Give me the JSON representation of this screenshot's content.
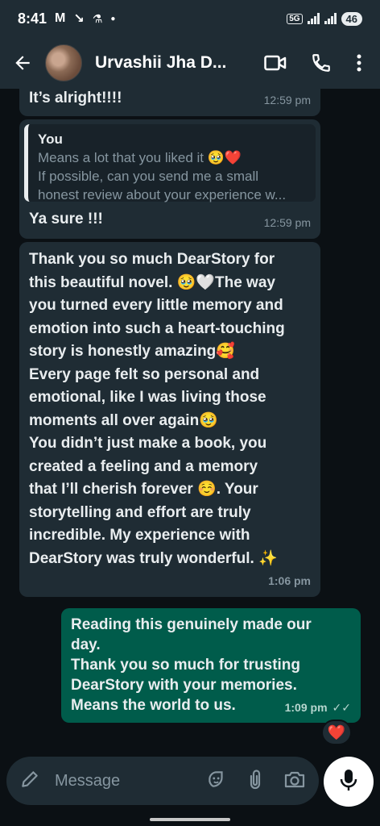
{
  "status_bar": {
    "time": "8:41",
    "network": "5G",
    "battery": "46"
  },
  "header": {
    "contact_name": "Urvashii Jha D...",
    "back_icon": "arrow-left-icon",
    "video_icon": "video-camera-icon",
    "call_icon": "phone-icon",
    "menu_icon": "more-vertical-icon"
  },
  "messages": [
    {
      "direction": "incoming",
      "text": "It’s alright!!!!",
      "time": "12:59 pm"
    },
    {
      "direction": "incoming",
      "quote_author": "You",
      "quote_line1": "Means a lot that you liked it 🥹❤️",
      "quote_line2": "If possible, can you send me a small",
      "quote_line3": "honest review about your experience w...",
      "text": "Ya sure !!!",
      "time": "12:59 pm"
    },
    {
      "direction": "incoming",
      "lines": [
        "Thank you so much DearStory for",
        "this beautiful novel. 🥹🤍The way",
        "you turned every little memory and",
        "emotion into such a heart-touching",
        "story is honestly amazing🥰",
        "Every page felt so personal and",
        "emotional, like I was living those",
        "moments all over again🥹",
        "You didn’t just make a book, you",
        "created a feeling and a memory",
        "that I’ll cherish forever ☺️.  Your",
        "storytelling and effort are truly",
        "incredible. My experience with",
        "DearStory was truly wonderful. ✨"
      ],
      "time": "1:06 pm"
    },
    {
      "direction": "outgoing",
      "lines": [
        "Reading this genuinely made our",
        "day.",
        "Thank you so much for trusting",
        "DearStory with your memories.",
        "Means the world to us."
      ],
      "time": "1:09 pm",
      "reaction": "❤️"
    }
  ],
  "composer": {
    "placeholder": "Message",
    "pen_icon": "pen-icon",
    "sticker_icon": "sticker-icon",
    "attach_icon": "paperclip-icon",
    "camera_icon": "camera-icon",
    "mic_icon": "microphone-icon"
  },
  "colors": {
    "header_bg": "#1f2c34",
    "chat_bg": "#0b1014",
    "incoming_bubble": "#1f2c34",
    "outgoing_bubble": "#005c4b",
    "meta_text": "#8696a0"
  }
}
